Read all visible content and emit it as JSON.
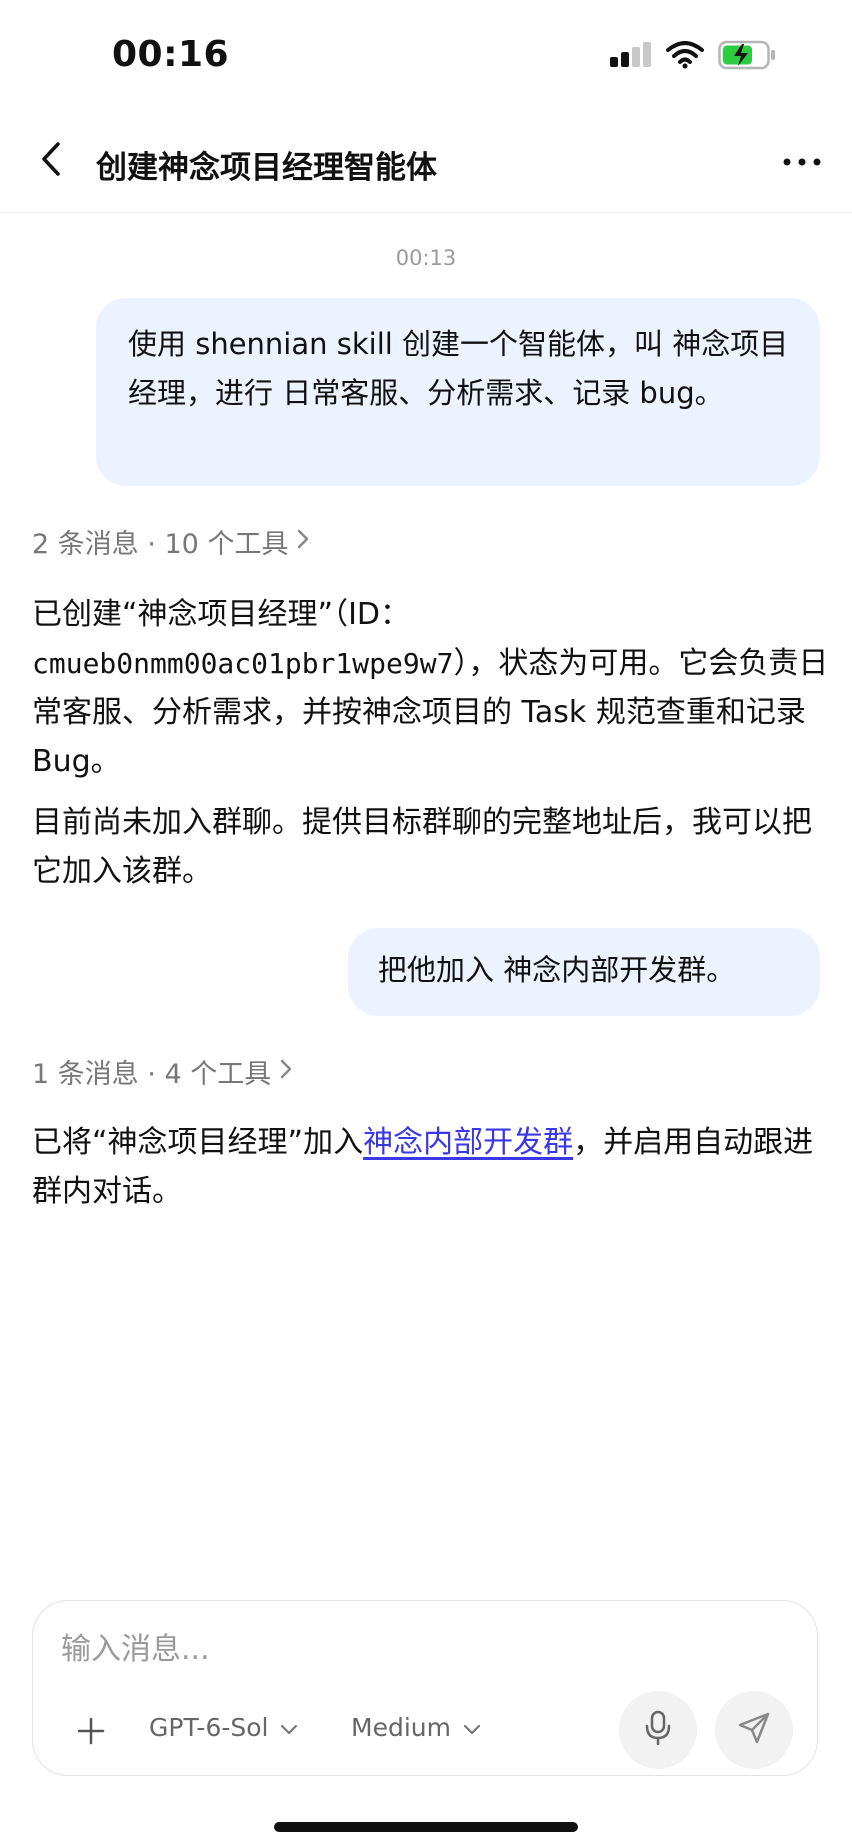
{
  "status_bar": {
    "time": "00:16",
    "icons": [
      "cellular-signal-icon",
      "wifi-icon",
      "battery-charging-icon"
    ]
  },
  "header": {
    "title": "创建神念项目经理智能体",
    "icons": [
      "chevron-left-icon",
      "more-horizontal-icon"
    ]
  },
  "conversation": {
    "timestamp": "00:13",
    "user_message_1": "使用 shennian skill 创建一个智能体，叫 神念项目经理，进行 日常客服、分析需求、记录 bug。",
    "tool_summary_1": "2 条消息 · 10 个工具",
    "assistant_message_1": {
      "text_before_id": "已创建“神念项目经理”（ID：",
      "agent_id": "cmueb0nmm00ac01pbr1wpe9w7",
      "text_after_id": "），状态为可用。它会负责日常客服、分析需求，并按神念项目的 Task 规范查重和记录 Bug。",
      "paragraph_2": "目前尚未加入群聊。提供目标群聊的完整地址后，我可以把它加入该群。"
    },
    "user_message_2": "把他加入 神念内部开发群。",
    "tool_summary_2": "1 条消息 · 4 个工具",
    "assistant_message_2": {
      "text_before_link": "已将“神念项目经理”加入",
      "link_text": "神念内部开发群",
      "text_after_link": "，并启用自动跟进群内对话。"
    }
  },
  "composer": {
    "placeholder": "输入消息...",
    "model": "GPT-6-Sol",
    "effort": "Medium",
    "icons": [
      "plus-icon",
      "chevron-down-icon",
      "microphone-icon",
      "send-icon"
    ]
  },
  "colors": {
    "user_bubble": "#ecf3fe",
    "link": "#3a37e6",
    "battery_charging": "#2ecc40"
  }
}
